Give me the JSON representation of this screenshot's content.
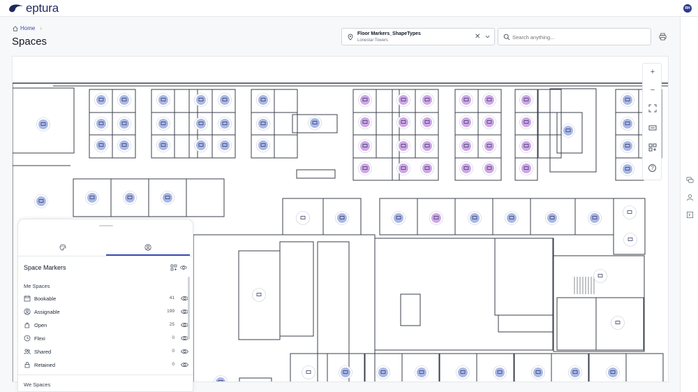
{
  "app": {
    "logo_text": "eptura",
    "user_initials": "RH"
  },
  "breadcrumb": {
    "home_label": "Home",
    "separator": "›"
  },
  "page": {
    "title": "Spaces"
  },
  "location": {
    "name": "Floor Markers_ShapeTypes",
    "building": "Lonestar Towers",
    "clear_glyph": "✕"
  },
  "search": {
    "placeholder": "Search anything..."
  },
  "map_controls": {
    "zoom_in": "+",
    "zoom_out": "−",
    "help": "?"
  },
  "panel": {
    "title": "Space Markers",
    "me_section": "Me Spaces",
    "we_section": "We Spaces",
    "rows": [
      {
        "label": "Bookable",
        "count": "41",
        "icon": "calendar-icon"
      },
      {
        "label": "Assignable",
        "count": "199",
        "icon": "person-circle-icon"
      },
      {
        "label": "Open",
        "count": "25",
        "icon": "open-hand-icon"
      },
      {
        "label": "Flexi",
        "count": "0",
        "icon": "clock-icon"
      },
      {
        "label": "Shared",
        "count": "0",
        "icon": "people-icon"
      },
      {
        "label": "Retained",
        "count": "0",
        "icon": "lock-icon"
      }
    ]
  },
  "colors": {
    "brand": "#1f2a5c",
    "accent": "#3b4bb0",
    "marker_blue": "#a9b8e6",
    "marker_purple": "#cfa6e6",
    "marker_beige": "#ffffff"
  }
}
